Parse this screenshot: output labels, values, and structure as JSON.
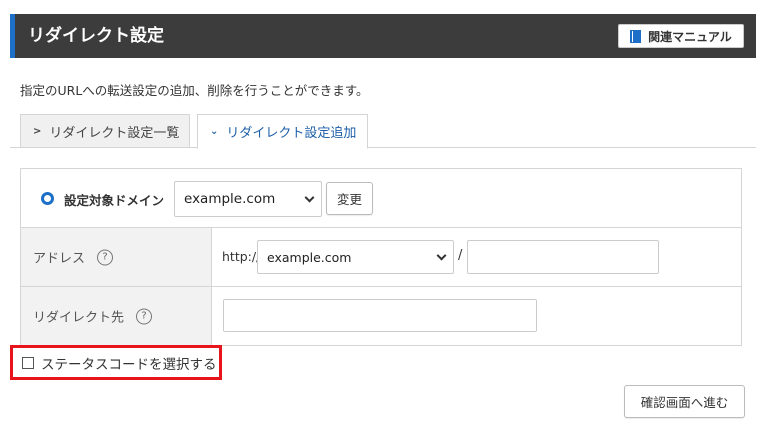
{
  "header": {
    "title": "リダイレクト設定",
    "manual_label": "関連マニュアル"
  },
  "description": "指定のURLへの転送設定の追加、削除を行うことができます。",
  "tabs": [
    {
      "label": "リダイレクト設定一覧",
      "active": false
    },
    {
      "label": "リダイレクト設定追加",
      "active": true
    }
  ],
  "form": {
    "domain": {
      "label": "設定対象ドメイン",
      "selected": "example.com",
      "change_label": "変更"
    },
    "address": {
      "label": "アドレス",
      "help": "?",
      "prefix": "http://",
      "domain_selected": "example.com",
      "separator": "/",
      "path_value": ""
    },
    "redirect": {
      "label": "リダイレクト先",
      "help": "?",
      "value": ""
    }
  },
  "status_code_option": {
    "label": "ステータスコードを選択する",
    "checked": false
  },
  "confirm_label": "確認画面へ進む",
  "colors": {
    "header_bg": "#3c3c3c",
    "accent": "#1d6fc8",
    "highlight": "#e8141c"
  }
}
